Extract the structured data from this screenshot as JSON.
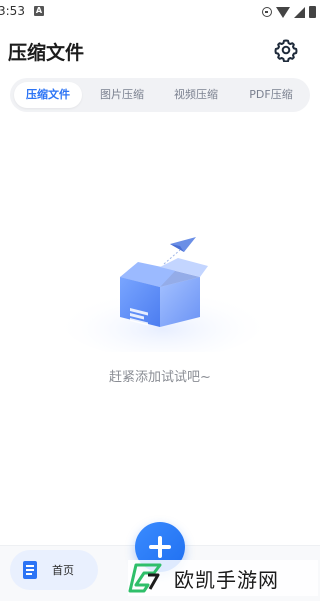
{
  "status_bar": {
    "time": "3:53",
    "notif_letter": "A"
  },
  "header": {
    "title": "压缩文件"
  },
  "tabs": [
    {
      "label": "压缩文件",
      "active": true
    },
    {
      "label": "图片压缩",
      "active": false
    },
    {
      "label": "视频压缩",
      "active": false
    },
    {
      "label": "PDF压缩",
      "active": false
    }
  ],
  "empty_state": {
    "message": "赶紧添加试试吧~"
  },
  "bottom_nav": {
    "home_label": "首页"
  },
  "watermark": {
    "text": "欧凯手游网"
  },
  "colors": {
    "accent": "#2c74f5",
    "fab": "#1f6ff0",
    "tab_bg": "#f1f2f5"
  }
}
